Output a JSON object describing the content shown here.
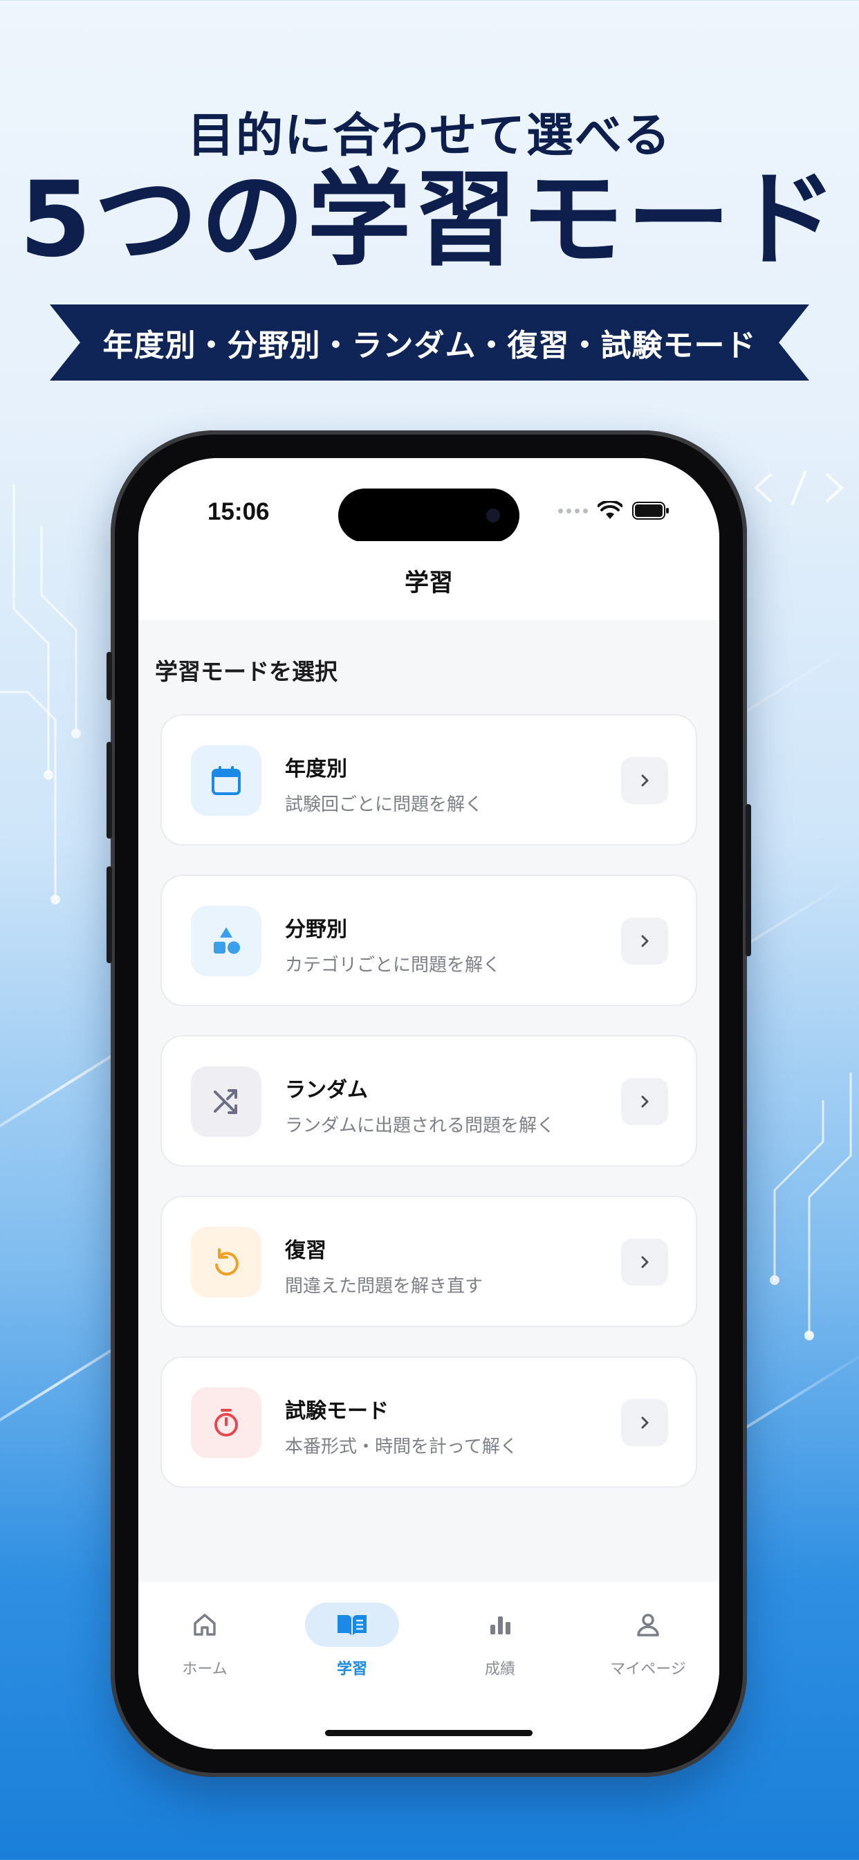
{
  "promo": {
    "headline_line1": "目的に合わせて選べる",
    "headline_line2": "5つの学習モード",
    "ribbon_text": "年度別・分野別・ランダム・復習・試験モード"
  },
  "status_bar": {
    "time": "15:06"
  },
  "header": {
    "title": "学習"
  },
  "section": {
    "title": "学習モードを選択"
  },
  "modes": [
    {
      "title": "年度別",
      "subtitle": "試験回ごとに問題を解く",
      "icon": "calendar-icon",
      "color": "#1a8ae6",
      "bg": "#e6f2fd"
    },
    {
      "title": "分野別",
      "subtitle": "カテゴリごとに問題を解く",
      "icon": "shapes-icon",
      "color": "#3aa0ee",
      "bg": "#e9f4fd"
    },
    {
      "title": "ランダム",
      "subtitle": "ランダムに出題される問題を解く",
      "icon": "shuffle-icon",
      "color": "#6b6e86",
      "bg": "#efeff3"
    },
    {
      "title": "復習",
      "subtitle": "間違えた問題を解き直す",
      "icon": "undo-icon",
      "color": "#f2a025",
      "bg": "#fff3e3"
    },
    {
      "title": "試験モード",
      "subtitle": "本番形式・時間を計って解く",
      "icon": "stopwatch-icon",
      "color": "#e5484d",
      "bg": "#fdebec"
    }
  ],
  "tabs": [
    {
      "label": "ホーム",
      "icon": "home-icon",
      "active": false
    },
    {
      "label": "学習",
      "icon": "book-icon",
      "active": true
    },
    {
      "label": "成績",
      "icon": "bar-chart-icon",
      "active": false
    },
    {
      "label": "マイページ",
      "icon": "person-icon",
      "active": false
    }
  ],
  "colors": {
    "accent": "#1a8ae6",
    "navy": "#0e1f4d"
  }
}
